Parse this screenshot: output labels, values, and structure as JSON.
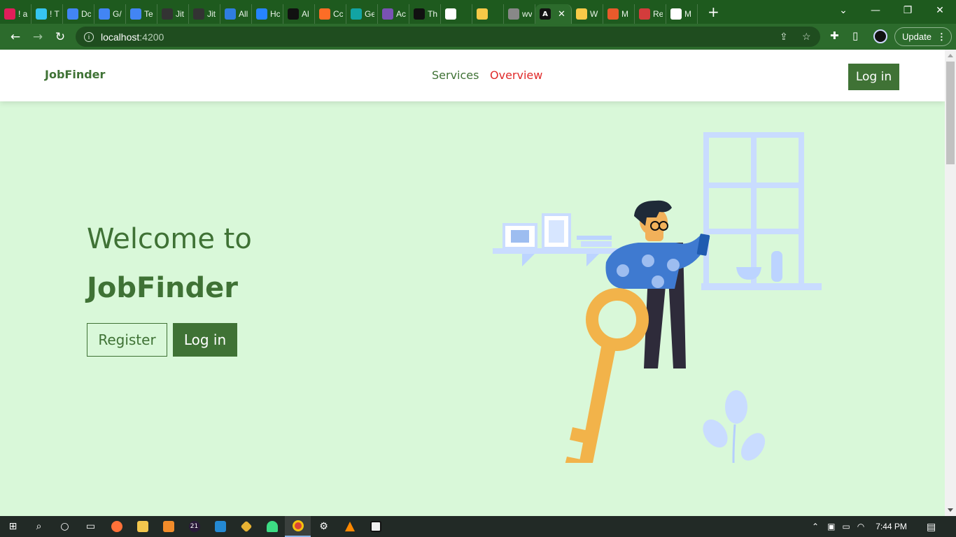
{
  "browser": {
    "tabs": [
      {
        "title": "! a",
        "icon": "slack-icon",
        "color": "#e01e5a"
      },
      {
        "title": "! T",
        "icon": "slack-icon",
        "color": "#36c5f0"
      },
      {
        "title": "Dc",
        "icon": "google-docs-icon",
        "color": "#4285f4"
      },
      {
        "title": "G/",
        "icon": "google-docs-icon",
        "color": "#4285f4"
      },
      {
        "title": "Te",
        "icon": "google-docs-icon",
        "color": "#4285f4"
      },
      {
        "title": "Jit",
        "icon": "jitsi-icon",
        "color": "#333333"
      },
      {
        "title": "Jit",
        "icon": "jitsi-icon",
        "color": "#333333"
      },
      {
        "title": "All",
        "icon": "link-icon",
        "color": "#2f7de1"
      },
      {
        "title": "Hc",
        "icon": "jira-icon",
        "color": "#2684ff"
      },
      {
        "title": "Al",
        "icon": "angular-icon",
        "color": "#111111"
      },
      {
        "title": "Cc",
        "icon": "gitlab-icon",
        "color": "#fc6d26"
      },
      {
        "title": "Ge",
        "icon": "diamond-icon",
        "color": "#12a4a4"
      },
      {
        "title": "Ac",
        "icon": "bootstrap-icon",
        "color": "#7952b3"
      },
      {
        "title": "Th",
        "icon": "github-icon",
        "color": "#111111"
      },
      {
        "title": "",
        "icon": "smiley-icon",
        "color": "#ffffff"
      },
      {
        "title": "",
        "icon": "emoji-icon",
        "color": "#f7c948"
      },
      {
        "title": "wv",
        "icon": "figma-icon",
        "color": "#888888"
      }
    ],
    "active_tab": {
      "icon": "angular-icon",
      "close": "✕"
    },
    "tabs_after": [
      {
        "title": "W",
        "icon": "emoji-icon",
        "color": "#f7c948"
      },
      {
        "title": "M",
        "icon": "moodle-icon",
        "color": "#e85a2b"
      },
      {
        "title": "Re",
        "icon": "store-icon",
        "color": "#d33c3c"
      },
      {
        "title": "M",
        "icon": "globe-icon",
        "color": "#ffffff"
      }
    ],
    "new_tab": "+",
    "url_host": "localhost",
    "url_port": ":4200",
    "update_label": "Update"
  },
  "navbar": {
    "brand": "JobFinder",
    "links": [
      "Services",
      "Overview"
    ],
    "login_label": "Log in"
  },
  "hero": {
    "welcome": "Welcome to",
    "title": "JobFinder",
    "register_label": "Register",
    "login_label": "Log in"
  },
  "taskbar": {
    "time": "7:44 PM",
    "badge": "21"
  },
  "colors": {
    "accent": "#3f7235",
    "active_link": "#e02a2a",
    "page_bg": "#d9f8d9",
    "browser_frame": "#1e5a1e"
  }
}
